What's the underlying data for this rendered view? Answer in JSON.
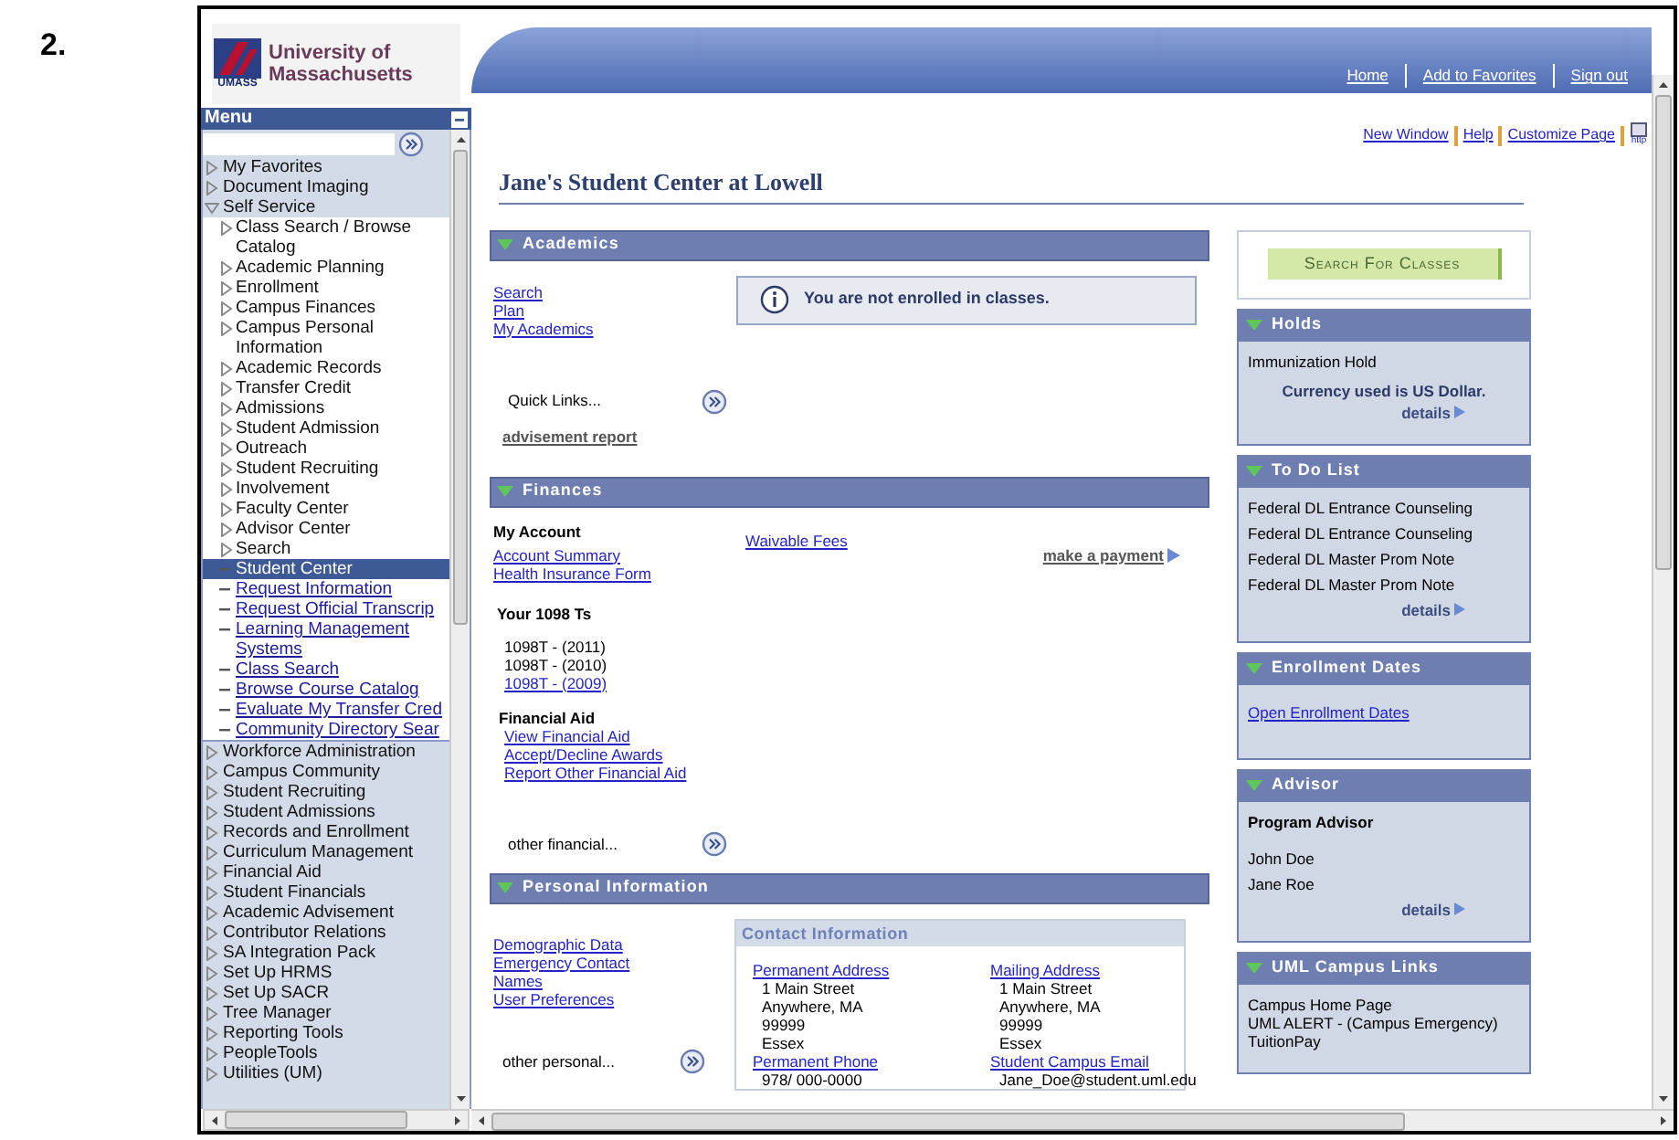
{
  "figure_label": "2.",
  "logo": {
    "line_1": "University of",
    "line_2": "Massachusetts",
    "mark": "UMASS"
  },
  "header_links": [
    "Home",
    "Add to Favorites",
    "Sign out"
  ],
  "menu": {
    "title": "Menu",
    "items": [
      {
        "label": "My Favorites",
        "expanded": false
      },
      {
        "label": "Document Imaging",
        "expanded": false
      },
      {
        "label": "Self Service",
        "expanded": true,
        "children": [
          {
            "label": "Class Search / Browse Catalog",
            "kind": "folder",
            "expanded": false,
            "selected": false
          },
          {
            "label": "Academic Planning",
            "kind": "folder",
            "expanded": false,
            "selected": false
          },
          {
            "label": "Enrollment",
            "kind": "folder",
            "expanded": false,
            "selected": false
          },
          {
            "label": "Campus Finances",
            "kind": "folder",
            "expanded": false,
            "selected": false
          },
          {
            "label": "Campus Personal Information",
            "kind": "folder",
            "expanded": false,
            "selected": false
          },
          {
            "label": "Academic Records",
            "kind": "folder",
            "expanded": false,
            "selected": false
          },
          {
            "label": "Transfer Credit",
            "kind": "folder",
            "expanded": false,
            "selected": false
          },
          {
            "label": "Admissions",
            "kind": "folder",
            "expanded": false,
            "selected": false
          },
          {
            "label": "Student Admission",
            "kind": "folder",
            "expanded": false,
            "selected": false
          },
          {
            "label": "Outreach",
            "kind": "folder",
            "expanded": false,
            "selected": false
          },
          {
            "label": "Student Recruiting",
            "kind": "folder",
            "expanded": false,
            "selected": false
          },
          {
            "label": "Involvement",
            "kind": "folder",
            "expanded": false,
            "selected": false
          },
          {
            "label": "Faculty Center",
            "kind": "folder",
            "expanded": false,
            "selected": false
          },
          {
            "label": "Advisor Center",
            "kind": "folder",
            "expanded": false,
            "selected": false
          },
          {
            "label": "Search",
            "kind": "folder",
            "expanded": false,
            "selected": false
          },
          {
            "label": "Student Center",
            "kind": "link",
            "selected": true
          },
          {
            "label": "Request Information",
            "kind": "link",
            "selected": false
          },
          {
            "label": "Request Official Transcrip",
            "kind": "link",
            "selected": false
          },
          {
            "label": "Learning Management Systems",
            "kind": "link",
            "selected": false
          },
          {
            "label": "Class Search",
            "kind": "link",
            "selected": false
          },
          {
            "label": "Browse Course Catalog",
            "kind": "link",
            "selected": false
          },
          {
            "label": "Evaluate My Transfer Cred",
            "kind": "link",
            "selected": false
          },
          {
            "label": "Community Directory Sear",
            "kind": "link",
            "selected": false
          }
        ]
      },
      {
        "label": "Workforce Administration",
        "expanded": false
      },
      {
        "label": "Campus Community",
        "expanded": false
      },
      {
        "label": "Student Recruiting",
        "expanded": false
      },
      {
        "label": "Student Admissions",
        "expanded": false
      },
      {
        "label": "Records and Enrollment",
        "expanded": false
      },
      {
        "label": "Curriculum Management",
        "expanded": false
      },
      {
        "label": "Financial Aid",
        "expanded": false
      },
      {
        "label": "Student Financials",
        "expanded": false
      },
      {
        "label": "Academic Advisement",
        "expanded": false
      },
      {
        "label": "Contributor Relations",
        "expanded": false
      },
      {
        "label": "SA Integration Pack",
        "expanded": false
      },
      {
        "label": "Set Up HRMS",
        "expanded": false
      },
      {
        "label": "Set Up SACR",
        "expanded": false
      },
      {
        "label": "Tree Manager",
        "expanded": false
      },
      {
        "label": "Reporting Tools",
        "expanded": false
      },
      {
        "label": "PeopleTools",
        "expanded": false
      },
      {
        "label": "Utilities (UM)",
        "expanded": false
      }
    ]
  },
  "pagelet_links": [
    "New Window",
    "Help",
    "Customize Page"
  ],
  "http_icon_label": "http",
  "page_title": "Jane's Student Center at Lowell",
  "academics": {
    "title": "Academics",
    "expanded": true,
    "links": [
      "Search",
      "Plan",
      "My Academics"
    ],
    "message": "You are not enrolled in classes.",
    "quick_links": "Quick Links...",
    "report_link": "advisement report"
  },
  "finances": {
    "title": "Finances",
    "expanded": true,
    "my_account": {
      "heading": "My Account",
      "links": [
        "Account Summary",
        "Health Insurance Form"
      ]
    },
    "waivable_fees": "Waivable Fees",
    "payment_link": "make a payment",
    "tax_forms": {
      "heading": "Your 1098 Ts",
      "items": [
        {
          "label": "1098T - (2011)",
          "kind": "text"
        },
        {
          "label": "1098T - (2010)",
          "kind": "text"
        },
        {
          "label": "1098T - (2009)",
          "kind": "link"
        }
      ]
    },
    "financial_aid": {
      "heading": "Financial Aid",
      "links": [
        "View Financial Aid",
        "Accept/Decline Awards",
        "Report Other Financial Aid"
      ]
    },
    "other": "other financial..."
  },
  "personal": {
    "title": "Personal Information",
    "expanded": true,
    "links": [
      "Demographic Data",
      "Emergency Contact",
      "Names",
      "User Preferences"
    ],
    "other": "other personal...",
    "contact": {
      "title": "Contact Information",
      "fields": [
        {
          "label": "Permanent Address",
          "lines": [
            "1 Main Street",
            "Anywhere, MA",
            "99999",
            "Essex"
          ]
        },
        {
          "label": "Mailing Address",
          "lines": [
            "1 Main Street",
            "Anywhere, MA",
            "99999",
            "Essex"
          ]
        },
        {
          "label": "Permanent Phone",
          "lines": [
            "978/ 000-0000"
          ]
        },
        {
          "label": "Student Campus Email",
          "lines": [
            "Jane_Doe@student.uml.edu"
          ]
        }
      ]
    }
  },
  "search_button": "Search For Classes",
  "panels": [
    {
      "title": "Holds",
      "expanded": true,
      "rows": [
        {
          "kind": "text",
          "text": "Immunization Hold"
        },
        {
          "kind": "note",
          "text": "Currency used is US Dollar."
        },
        {
          "kind": "details",
          "text": "details"
        }
      ]
    },
    {
      "title": "To Do List",
      "expanded": true,
      "rows": [
        {
          "kind": "text",
          "text": "Federal DL Entrance Counseling"
        },
        {
          "kind": "text",
          "text": "Federal DL Entrance Counseling"
        },
        {
          "kind": "text",
          "text": "Federal DL Master Prom Note"
        },
        {
          "kind": "text",
          "text": "Federal DL Master Prom Note"
        },
        {
          "kind": "details",
          "text": "details"
        }
      ]
    },
    {
      "title": "Enrollment Dates",
      "expanded": true,
      "rows": [
        {
          "kind": "link",
          "text": "Open Enrollment Dates"
        }
      ]
    },
    {
      "title": "Advisor",
      "expanded": true,
      "rows": [
        {
          "kind": "heading",
          "text": "Program Advisor"
        },
        {
          "kind": "text",
          "text": "John Doe"
        },
        {
          "kind": "text",
          "text": "Jane Roe"
        },
        {
          "kind": "details",
          "text": "details"
        }
      ]
    },
    {
      "title": "UML Campus Links",
      "expanded": true,
      "rows": [
        {
          "kind": "plain",
          "text": "Campus Home Page"
        },
        {
          "kind": "plain",
          "text": "UML ALERT - (Campus Emergency)"
        },
        {
          "kind": "plain",
          "text": "TuitionPay"
        }
      ]
    }
  ]
}
